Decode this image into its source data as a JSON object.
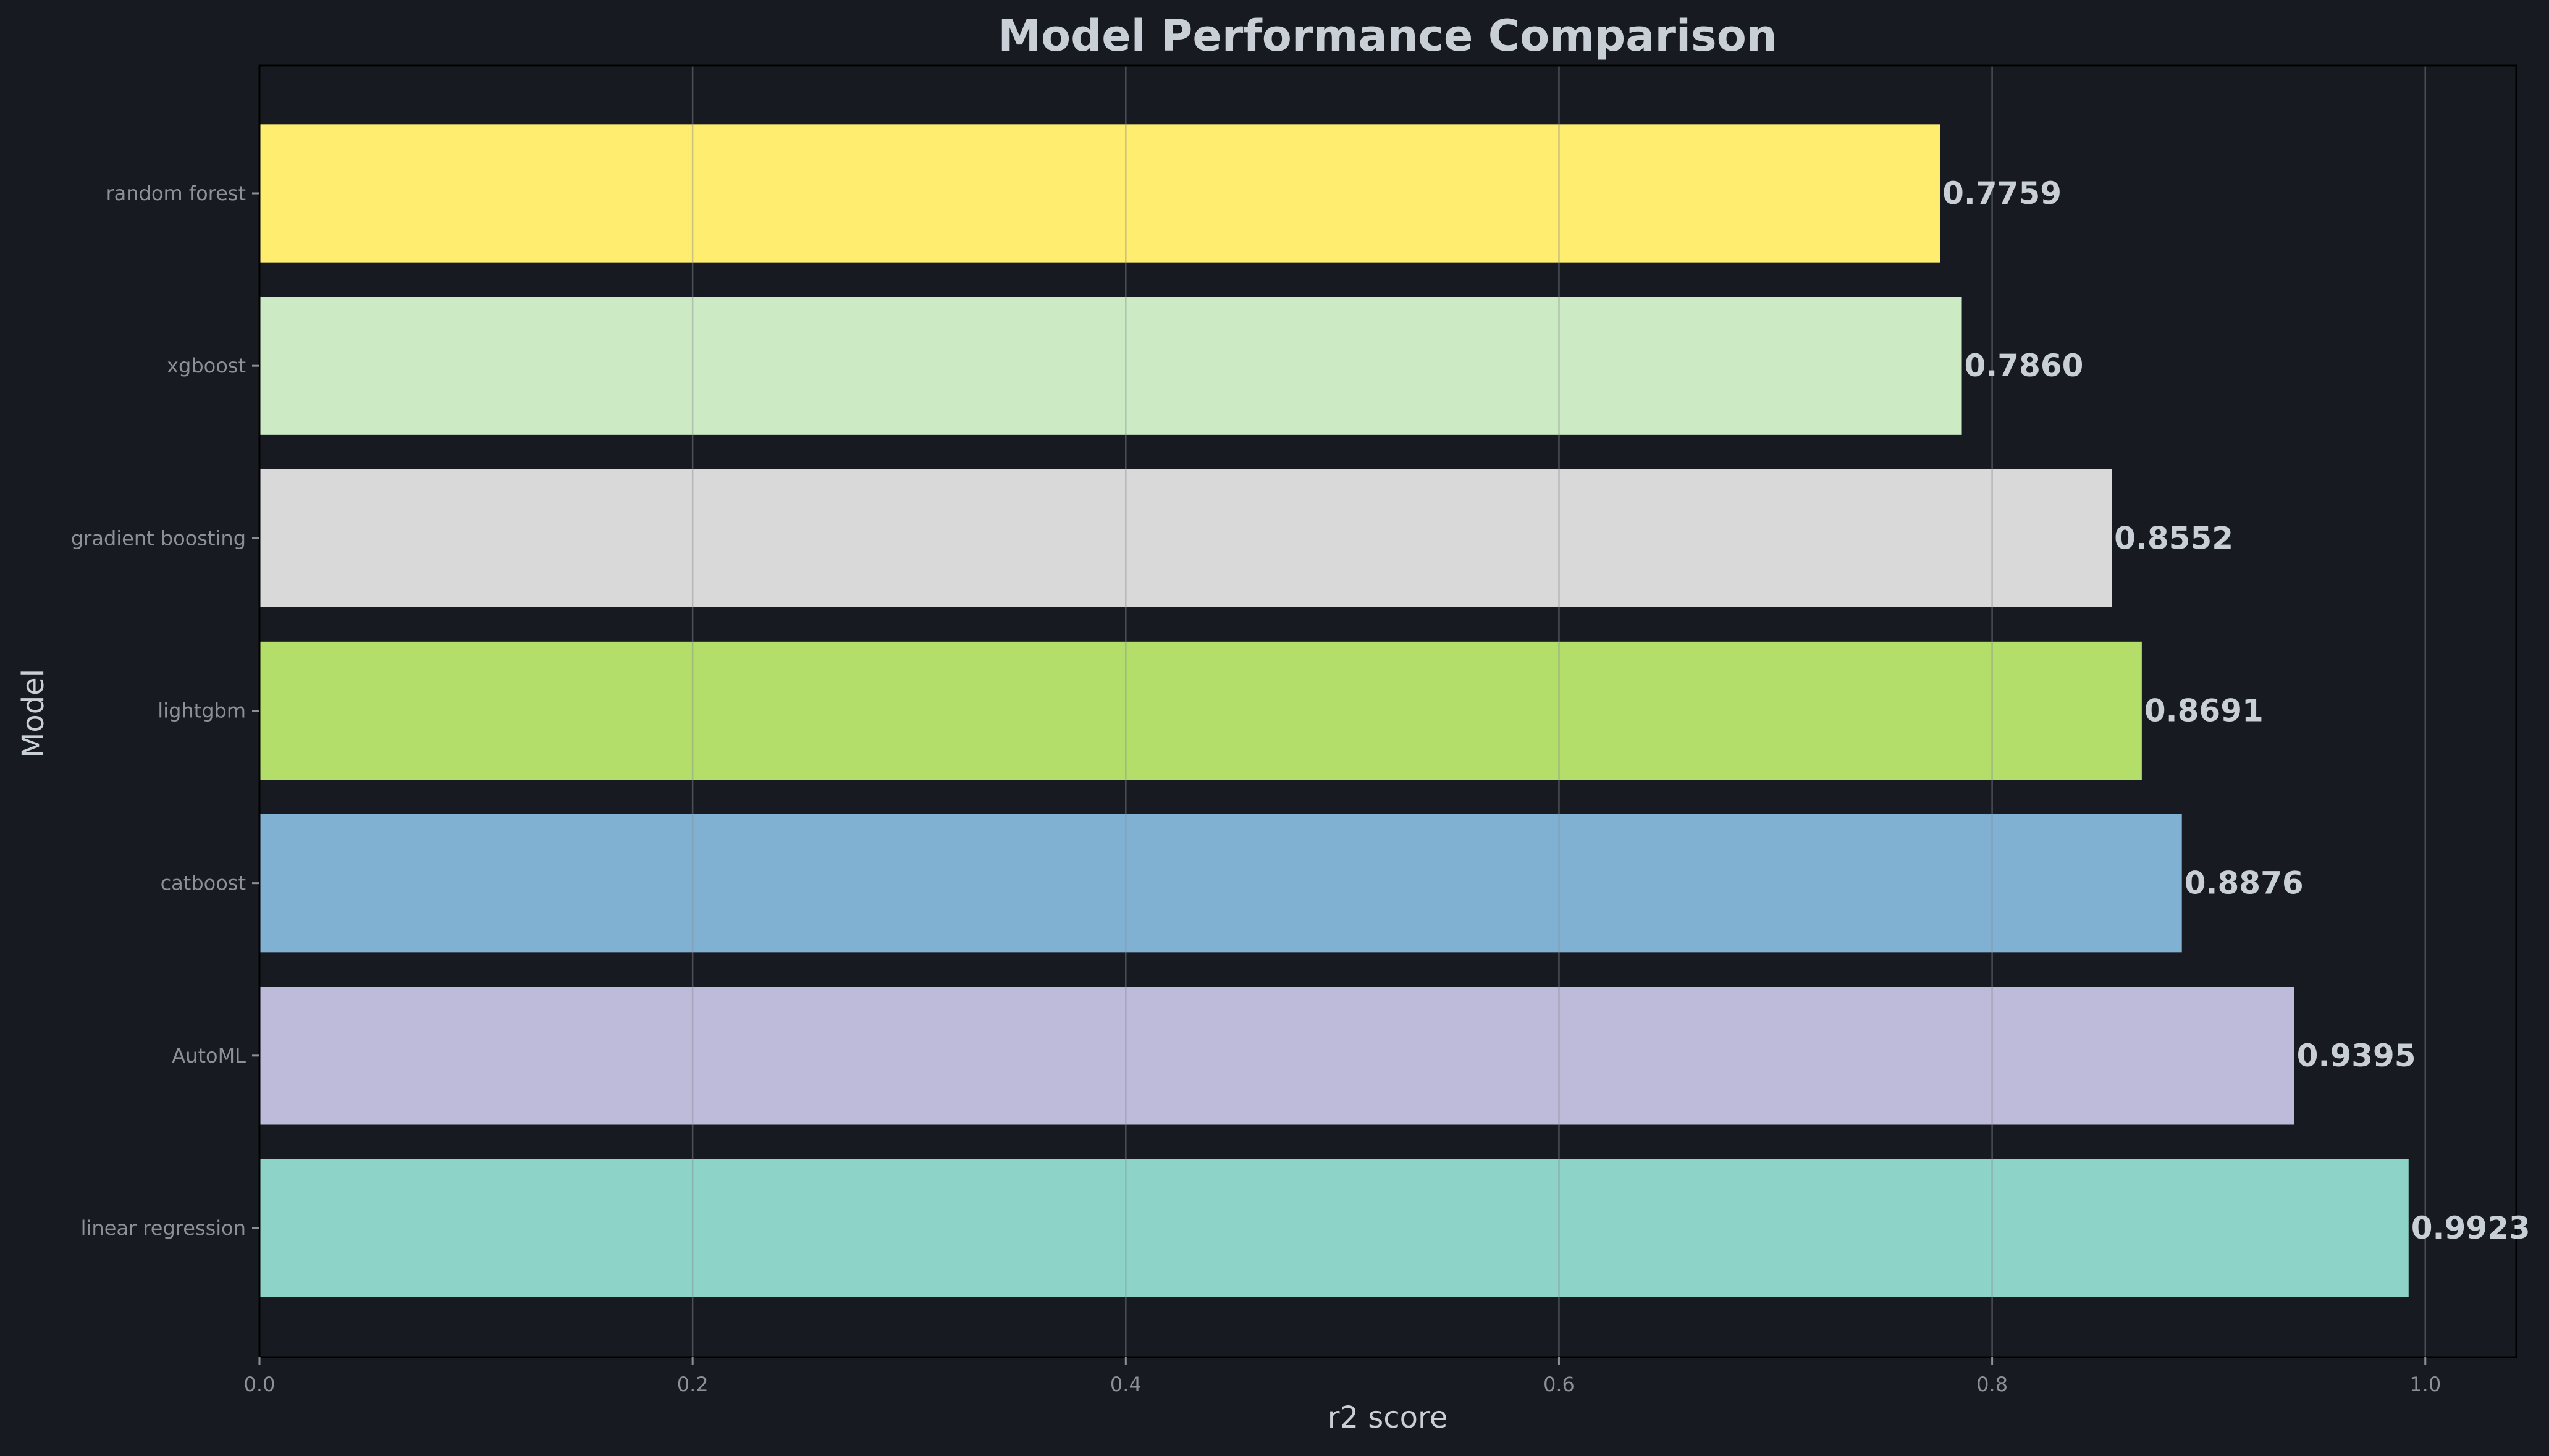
{
  "chart_data": {
    "type": "bar",
    "orientation": "horizontal",
    "title": "Model Performance Comparison",
    "xlabel": "r2 score",
    "ylabel": "Model",
    "categories": [
      "random forest",
      "xgboost",
      "gradient boosting",
      "lightgbm",
      "catboost",
      "AutoML",
      "linear regression"
    ],
    "values": [
      0.7759,
      0.786,
      0.8552,
      0.8691,
      0.8876,
      0.9395,
      0.9923
    ],
    "value_labels": [
      "0.7759",
      "0.7860",
      "0.8552",
      "0.8691",
      "0.8876",
      "0.9395",
      "0.9923"
    ],
    "bar_colors": [
      "#ffed6f",
      "#ccebc5",
      "#d9d9d9",
      "#b3de69",
      "#80b1d3",
      "#bebada",
      "#8dd3c7"
    ],
    "xlim": [
      0,
      1.042
    ],
    "xticks": [
      0.0,
      0.2,
      0.4,
      0.6,
      0.8,
      1.0
    ],
    "xtick_labels": [
      "0.0",
      "0.2",
      "0.4",
      "0.6",
      "0.8",
      "1.0"
    ],
    "grid": "x",
    "colors": {
      "background": "#171b21",
      "text": "#c9cfd6",
      "tick_text": "#8c9199",
      "axes_edge": "#000000",
      "grid": "#8a8f96"
    }
  }
}
